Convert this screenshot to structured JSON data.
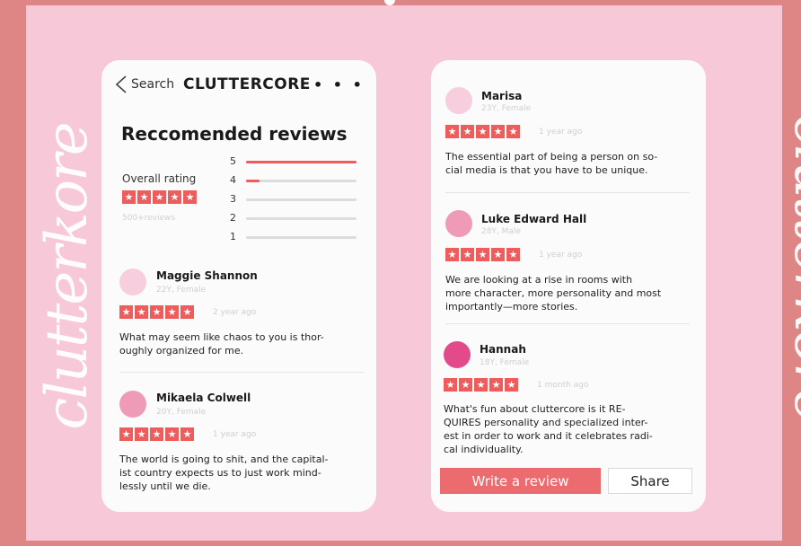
{
  "decor": {
    "left_script": "clutterkore",
    "right_script": "clutterkore"
  },
  "header": {
    "back_label": "Search",
    "app_title": "CLUTTERCORE",
    "more_icon": "more-dots-icon"
  },
  "summary": {
    "title": "Reccomended reviews",
    "overall_label": "Overall rating",
    "overall_stars": 5,
    "review_count": "500+reviews",
    "distribution": [
      {
        "stars": "5",
        "fraction": 1.0
      },
      {
        "stars": "4",
        "fraction": 0.12
      },
      {
        "stars": "3",
        "fraction": 0
      },
      {
        "stars": "2",
        "fraction": 0
      },
      {
        "stars": "1",
        "fraction": 0
      }
    ]
  },
  "reviews_left": [
    {
      "name": "Maggie Shannon",
      "meta": "22Y, Female",
      "stars": 5,
      "time": "2 year ago",
      "text_lines": [
        "What may seem like chaos to you is thor-",
        "oughly organized for me."
      ],
      "avatar_color": "#f6cedd"
    },
    {
      "name": "Mikaela Colwell",
      "meta": "20Y, Female",
      "stars": 5,
      "time": "1 year ago",
      "text_lines": [
        "The world is going to shit, and the capital-",
        "ist country expects us to just work mind-",
        "lessly until we die."
      ],
      "avatar_color": "#ef9ab6"
    }
  ],
  "reviews_right": [
    {
      "name": "Marisa",
      "meta": "23Y, Female",
      "stars": 5,
      "time": "1 year ago",
      "text_lines": [
        "The essential part of being a person on so-",
        "cial media is that you have to be unique."
      ],
      "avatar_color": "#f6cedd"
    },
    {
      "name": "Luke Edward Hall",
      "meta": "28Y, Male",
      "stars": 5,
      "time": "1 year ago",
      "text_lines": [
        "We are looking at a rise in rooms with",
        "more character, more personality and most",
        "importantly—more stories."
      ],
      "avatar_color": "#ef9ab6"
    },
    {
      "name": "Hannah",
      "meta": "18Y, Female",
      "stars": 5,
      "time": "1 month ago",
      "text_lines": [
        "What's fun about cluttercore is it RE-",
        "QUIRES personality and specialized inter-",
        "est in order to work and it celebrates radi-",
        "cal individuality."
      ],
      "avatar_color": "#e24a8a"
    }
  ],
  "actions": {
    "write_review": "Write a review",
    "share": "Share"
  },
  "colors": {
    "accent": "#ee5c5c",
    "background": "#f7c9d8",
    "border": "#de8585"
  }
}
